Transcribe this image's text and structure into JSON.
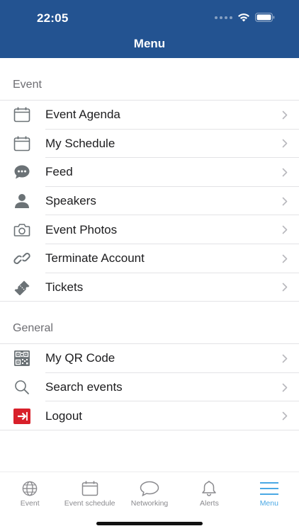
{
  "status_bar": {
    "time": "22:05"
  },
  "header": {
    "title": "Menu"
  },
  "sections": {
    "event": {
      "title": "Event",
      "items": [
        {
          "label": "Event Agenda",
          "icon": "calendar-icon"
        },
        {
          "label": "My Schedule",
          "icon": "calendar-icon"
        },
        {
          "label": "Feed",
          "icon": "chat-bubble-icon"
        },
        {
          "label": "Speakers",
          "icon": "person-icon"
        },
        {
          "label": "Event Photos",
          "icon": "camera-icon"
        },
        {
          "label": "Terminate Account",
          "icon": "link-icon"
        },
        {
          "label": "Tickets",
          "icon": "ticket-icon"
        }
      ]
    },
    "general": {
      "title": "General",
      "items": [
        {
          "label": "My QR Code",
          "icon": "qr-code-icon"
        },
        {
          "label": "Search events",
          "icon": "search-icon"
        },
        {
          "label": "Logout",
          "icon": "logout-icon"
        }
      ]
    }
  },
  "tabbar": {
    "tabs": [
      {
        "label": "Event",
        "icon": "globe-icon",
        "active": false
      },
      {
        "label": "Event schedule",
        "icon": "calendar-icon",
        "active": false
      },
      {
        "label": "Networking",
        "icon": "speech-bubble-icon",
        "active": false
      },
      {
        "label": "Alerts",
        "icon": "bell-icon",
        "active": false
      },
      {
        "label": "Menu",
        "icon": "hamburger-icon",
        "active": true
      }
    ]
  },
  "colors": {
    "header_bg": "#235391",
    "accent": "#4aa8e4",
    "logout_red": "#d8202a",
    "icon_gray": "#6b7276"
  }
}
